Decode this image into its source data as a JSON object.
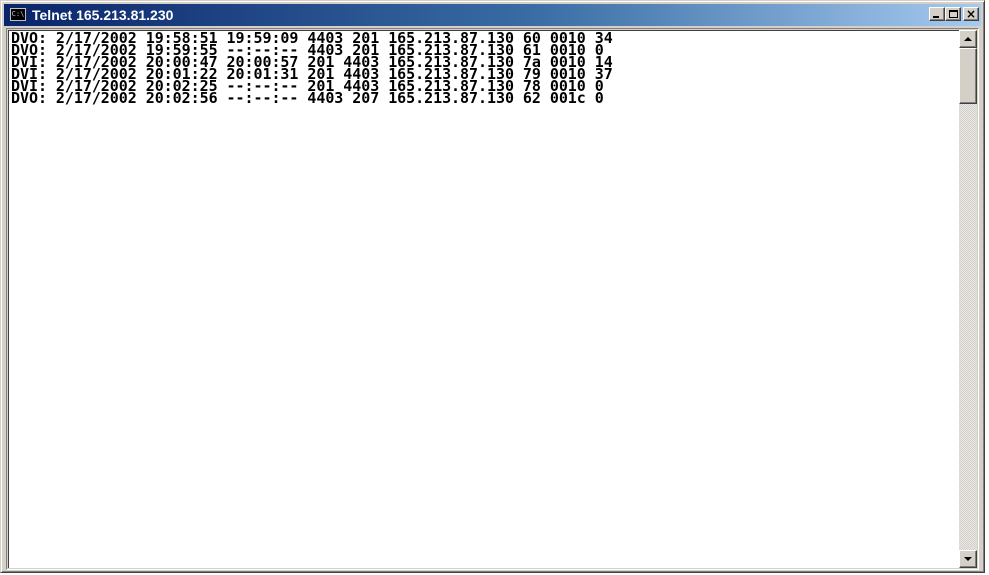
{
  "window": {
    "title": "Telnet 165.213.81.230",
    "icon": "console-icon",
    "icon_text": "C:\\",
    "controls": {
      "minimize_icon": "minimize-icon",
      "maximize_icon": "maximize-icon",
      "close_icon": "close-icon",
      "close_glyph": "×"
    }
  },
  "terminal": {
    "lines": [
      "DVO: 2/17/2002 19:58:51 19:59:09 4403 201 165.213.87.130 60 0010 34",
      "DVO: 2/17/2002 19:59:55 --:--:-- 4403 201 165.213.87.130 61 0010 0",
      "DVI: 2/17/2002 20:00:47 20:00:57 201 4403 165.213.87.130 7a 0010 14",
      "DVI: 2/17/2002 20:01:22 20:01:31 201 4403 165.213.87.130 79 0010 37",
      "DVI: 2/17/2002 20:02:25 --:--:-- 201 4403 165.213.87.130 78 0010 0",
      "DVO: 2/17/2002 20:02:56 --:--:-- 4403 207 165.213.87.130 62 001c 0"
    ]
  },
  "scrollbar": {
    "up_icon": "scroll-up-arrow-icon",
    "down_icon": "scroll-down-arrow-icon"
  },
  "colors": {
    "title_active_start": "#0a246a",
    "title_active_end": "#a6caf0",
    "chrome": "#d4d0c8",
    "terminal_bg": "#ffffff",
    "terminal_fg": "#000000"
  }
}
